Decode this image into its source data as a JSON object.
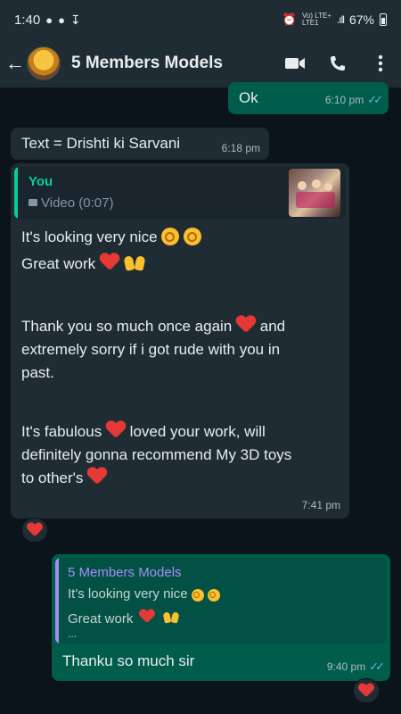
{
  "status": {
    "time": "1:40",
    "network": "Vo) LTE+",
    "network2": "LTE1",
    "battery": "67%"
  },
  "header": {
    "title": "5 Members Models"
  },
  "messages": {
    "ok": {
      "text": "Ok",
      "time": "6:10 pm"
    },
    "drishti": {
      "text": "Text = Drishti ki Sarvani",
      "time": "6:18 pm"
    },
    "long": {
      "quote_author": "You",
      "quote_media": "Video (0:07)",
      "line1": "It's looking very nice",
      "line2": "Great work",
      "line3a": "Thank you so much once again",
      "line3b": "and",
      "line4": "extremely sorry if i got rude with you in",
      "line5": "past.",
      "line6a": "It's fabulous",
      "line6b": "loved your work, will",
      "line7": "definitely gonna recommend My 3D toys",
      "line8": "to other's",
      "time": "7:41 pm"
    },
    "reply": {
      "quote_author": "5 Members Models",
      "quote_line1": "It's looking very nice",
      "quote_line2": "Great work",
      "quote_more": "...",
      "text": "Thanku so much sir",
      "time": "9:40 pm"
    }
  },
  "colors": {
    "outgoing": "#005c4b",
    "incoming": "#1f2c34",
    "tick_read": "#53bdeb",
    "quote_you": "#06cf9c",
    "quote_group": "#a78bfa"
  }
}
